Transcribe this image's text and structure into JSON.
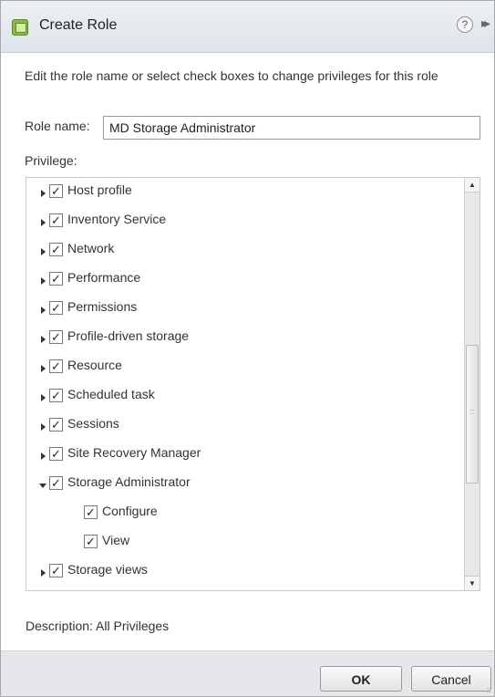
{
  "dialog": {
    "title": "Create Role",
    "help_icon": "?",
    "collapse_icon": "▸▸",
    "intro": "Edit the role name or select check boxes to change privileges for this role",
    "role_name_label": "Role name:",
    "role_name_value": "MD Storage Administrator",
    "privilege_label": "Privilege:",
    "description_label": "Description:",
    "description_value": "All Privileges",
    "ok_label": "OK",
    "cancel_label": "Cancel"
  },
  "privileges": [
    {
      "label": "Host profile",
      "checked": true,
      "level": 0,
      "expanded": false
    },
    {
      "label": "Inventory Service",
      "checked": true,
      "level": 0,
      "expanded": false
    },
    {
      "label": "Network",
      "checked": true,
      "level": 0,
      "expanded": false
    },
    {
      "label": "Performance",
      "checked": true,
      "level": 0,
      "expanded": false
    },
    {
      "label": "Permissions",
      "checked": true,
      "level": 0,
      "expanded": false
    },
    {
      "label": "Profile-driven storage",
      "checked": true,
      "level": 0,
      "expanded": false
    },
    {
      "label": "Resource",
      "checked": true,
      "level": 0,
      "expanded": false
    },
    {
      "label": "Scheduled task",
      "checked": true,
      "level": 0,
      "expanded": false
    },
    {
      "label": "Sessions",
      "checked": true,
      "level": 0,
      "expanded": false
    },
    {
      "label": "Site Recovery Manager",
      "checked": true,
      "level": 0,
      "expanded": false
    },
    {
      "label": "Storage Administrator",
      "checked": true,
      "level": 0,
      "expanded": true
    },
    {
      "label": "Configure",
      "checked": true,
      "level": 1,
      "leaf": true
    },
    {
      "label": "View",
      "checked": true,
      "level": 1,
      "leaf": true
    },
    {
      "label": "Storage views",
      "checked": true,
      "level": 0,
      "expanded": false
    }
  ],
  "icons": {
    "app": "role-folder-icon",
    "check": "✓",
    "scroll_up": "▲",
    "scroll_down": "▼",
    "grip": "::"
  },
  "colors": {
    "titlebar": "#dde3e9",
    "footer": "#e5e7ea",
    "border": "#a9a9a9"
  }
}
